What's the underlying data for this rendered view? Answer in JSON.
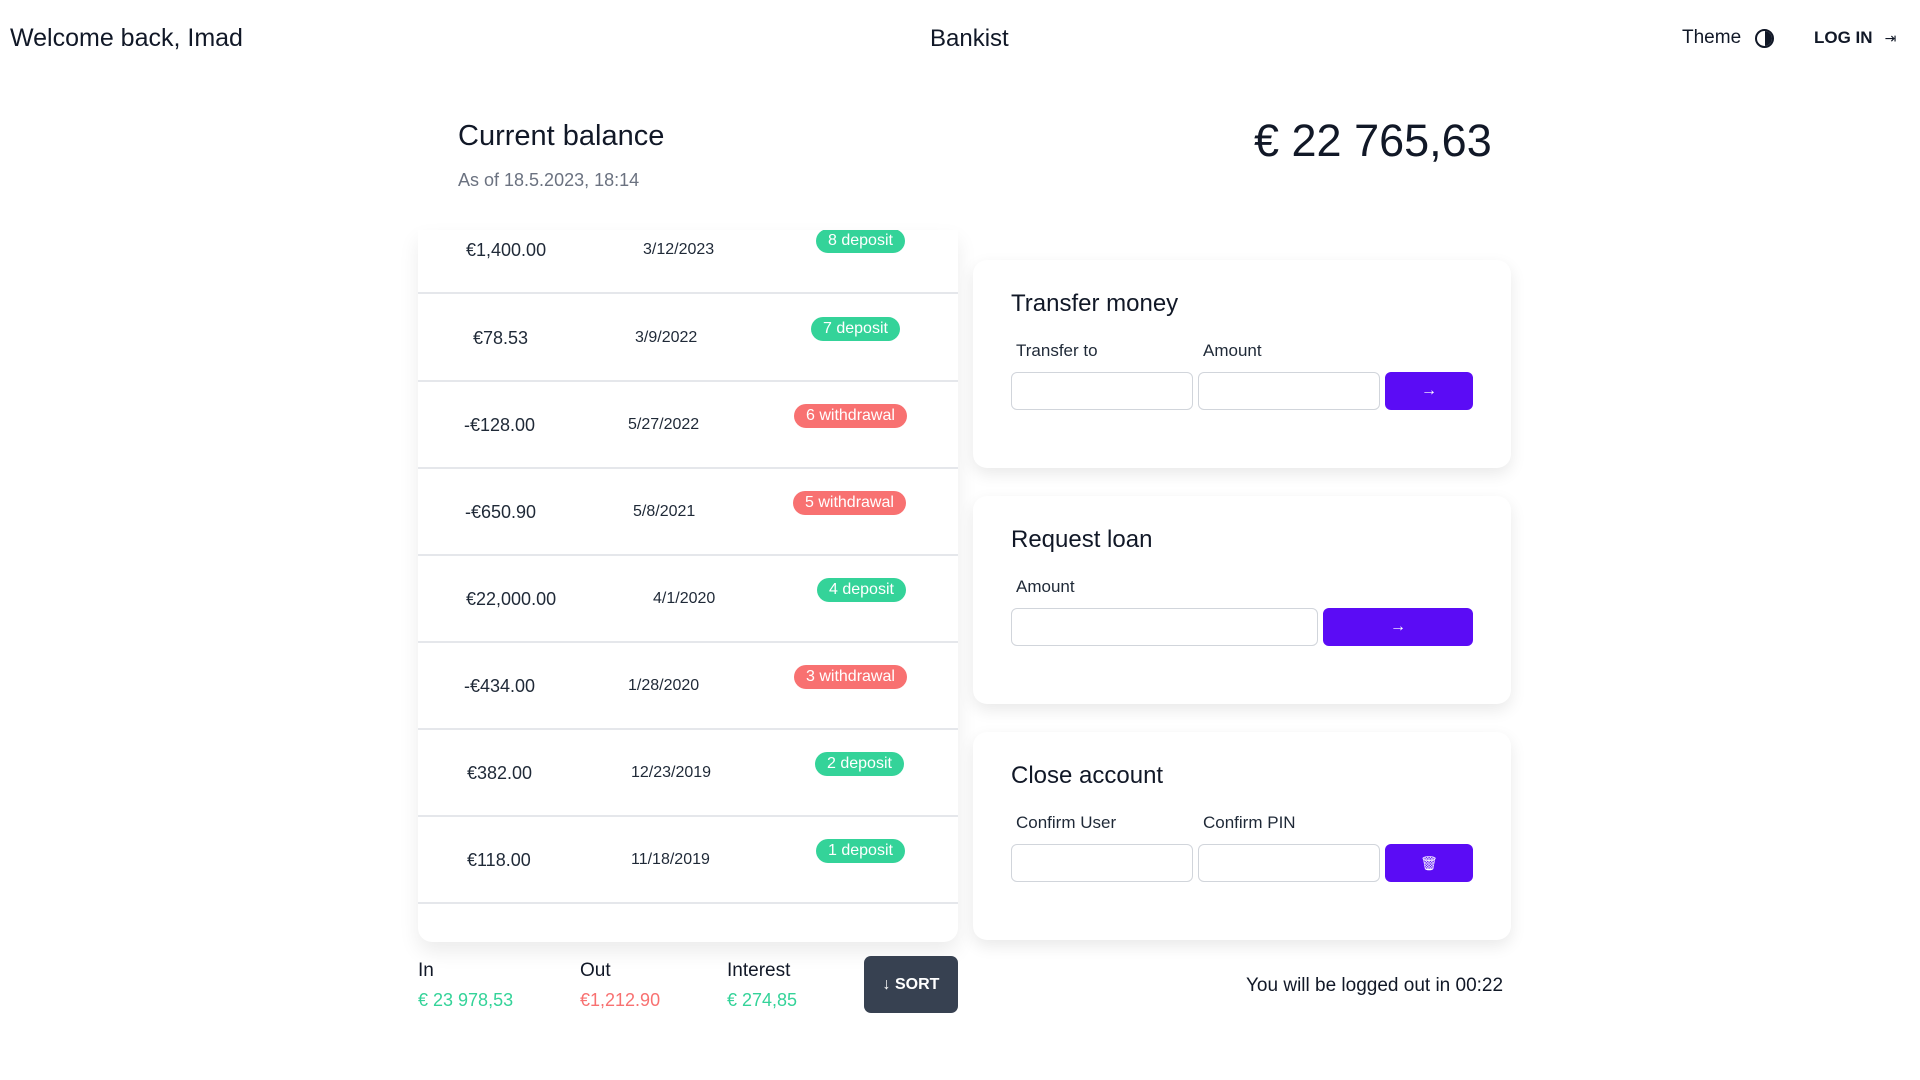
{
  "header": {
    "welcome": "Welcome back, Imad",
    "brand": "Bankist",
    "theme_label": "Theme",
    "theme_icon": "contrast-icon",
    "login_label": "LOG IN",
    "login_icon": "login-icon"
  },
  "balance": {
    "label": "Current balance",
    "date": "As of 18.5.2023, 18:14",
    "value": "€ 22 765,63"
  },
  "movements": [
    {
      "amount": "€1,400.00",
      "date": "3/12/2023",
      "badge": "8 deposit",
      "type": "deposit"
    },
    {
      "amount": "€78.53",
      "date": "3/9/2022",
      "badge": "7 deposit",
      "type": "deposit"
    },
    {
      "amount": "-€128.00",
      "date": "5/27/2022",
      "badge": "6 withdrawal",
      "type": "withdrawal"
    },
    {
      "amount": "-€650.90",
      "date": "5/8/2021",
      "badge": "5 withdrawal",
      "type": "withdrawal"
    },
    {
      "amount": "€22,000.00",
      "date": "4/1/2020",
      "badge": "4 deposit",
      "type": "deposit"
    },
    {
      "amount": "-€434.00",
      "date": "1/28/2020",
      "badge": "3 withdrawal",
      "type": "withdrawal"
    },
    {
      "amount": "€382.00",
      "date": "12/23/2019",
      "badge": "2 deposit",
      "type": "deposit"
    },
    {
      "amount": "€118.00",
      "date": "11/18/2019",
      "badge": "1 deposit",
      "type": "deposit"
    }
  ],
  "summary": {
    "in_label": "In",
    "in_value": "€ 23 978,53",
    "out_label": "Out",
    "out_value": "€1,212.90",
    "interest_label": "Interest",
    "interest_value": "€ 274,85",
    "sort_label": "↓ SORT"
  },
  "transfer": {
    "title": "Transfer money",
    "to_label": "Transfer to",
    "amount_label": "Amount",
    "to_value": "",
    "amount_value": "",
    "button_icon": "→"
  },
  "loan": {
    "title": "Request loan",
    "amount_label": "Amount",
    "amount_value": "",
    "button_icon": "→"
  },
  "close": {
    "title": "Close account",
    "user_label": "Confirm User",
    "pin_label": "Confirm PIN",
    "user_value": "",
    "pin_value": "",
    "button_icon": "🗑"
  },
  "logout_text": "You will be logged out in 00:22",
  "colors": {
    "deposit": "#34d399",
    "withdrawal": "#f87171",
    "accent": "#5b0cf5",
    "sort_button": "#374151"
  }
}
